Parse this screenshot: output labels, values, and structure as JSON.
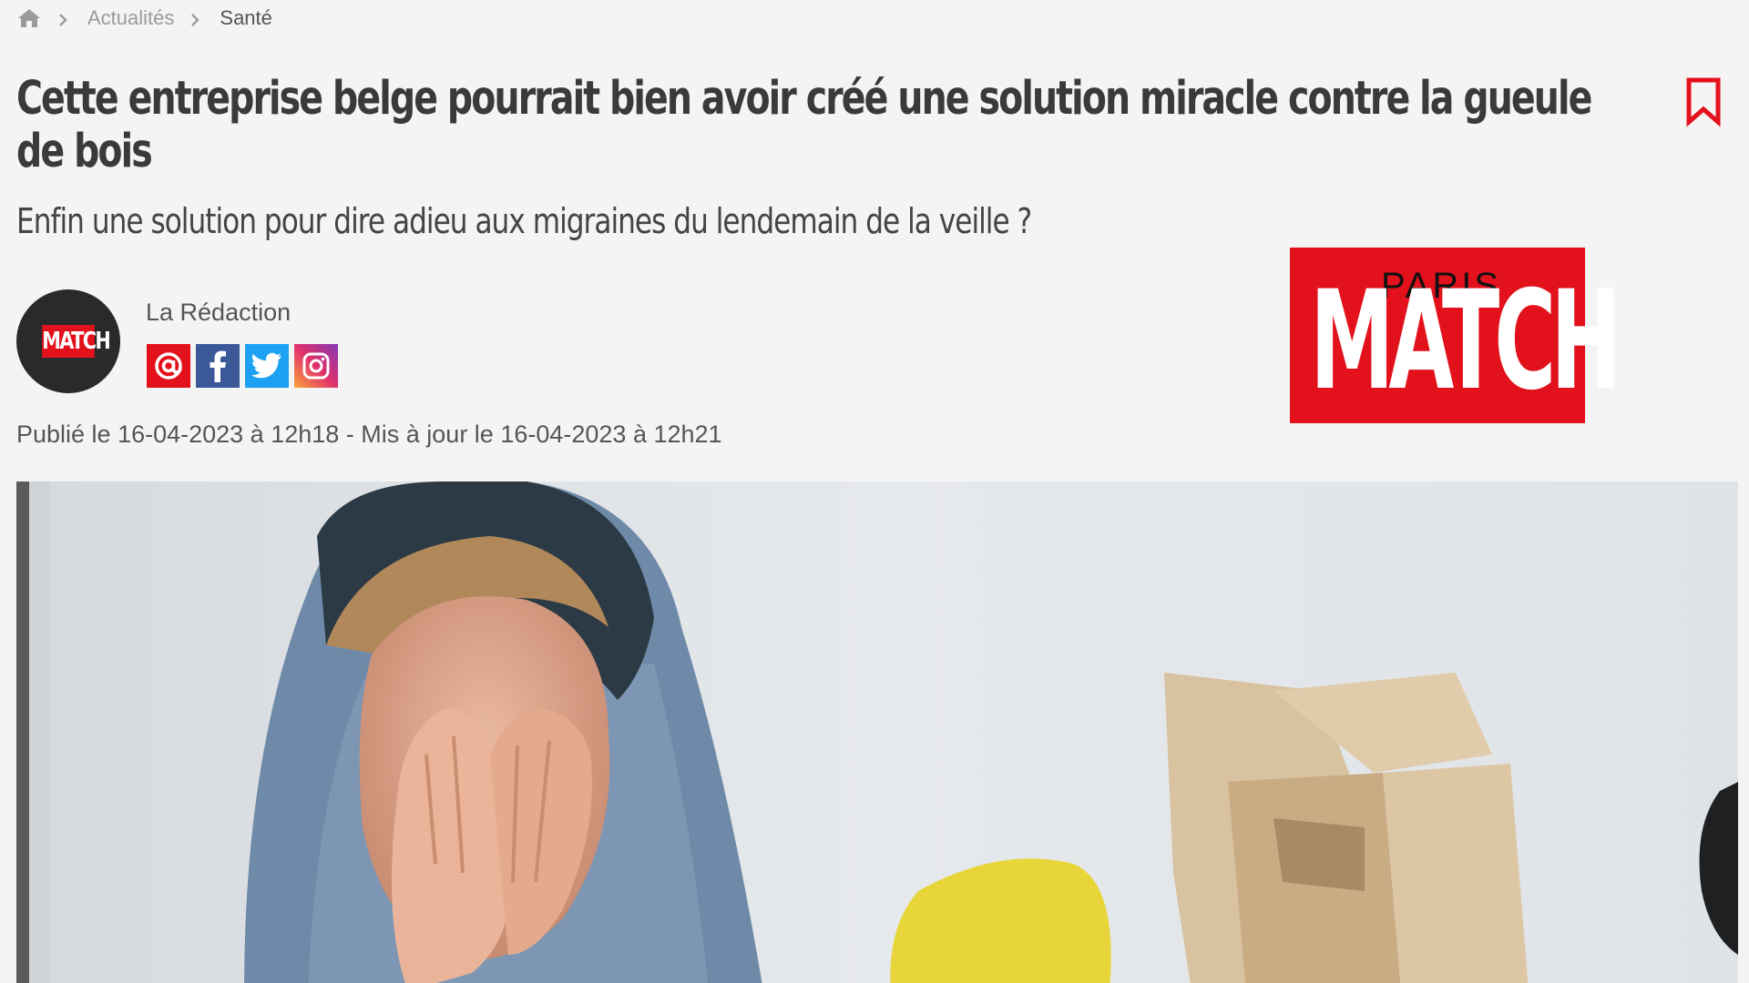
{
  "breadcrumb": {
    "home_icon": "home-icon",
    "items": [
      "Actualités",
      "Santé"
    ]
  },
  "article": {
    "title": "Cette entreprise belge pourrait bien avoir créé une solution miracle contre la gueule de bois",
    "subtitle": "Enfin une solution pour dire adieu aux migraines du lendemain de la veille ?",
    "author": "La Rédaction",
    "dates": "Publié le 16-04-2023 à 12h18 - Mis à jour le 16-04-2023 à 12h21"
  },
  "avatar_logo": "MATCH",
  "socials": [
    "email-icon",
    "facebook-icon",
    "twitter-icon",
    "instagram-icon"
  ],
  "logo": {
    "paris": "PARIS",
    "match": "MATCH"
  },
  "colors": {
    "brand_red": "#e3111b",
    "background": "#f4f4f4",
    "facebook": "#3b5998",
    "twitter": "#1da1f2"
  }
}
